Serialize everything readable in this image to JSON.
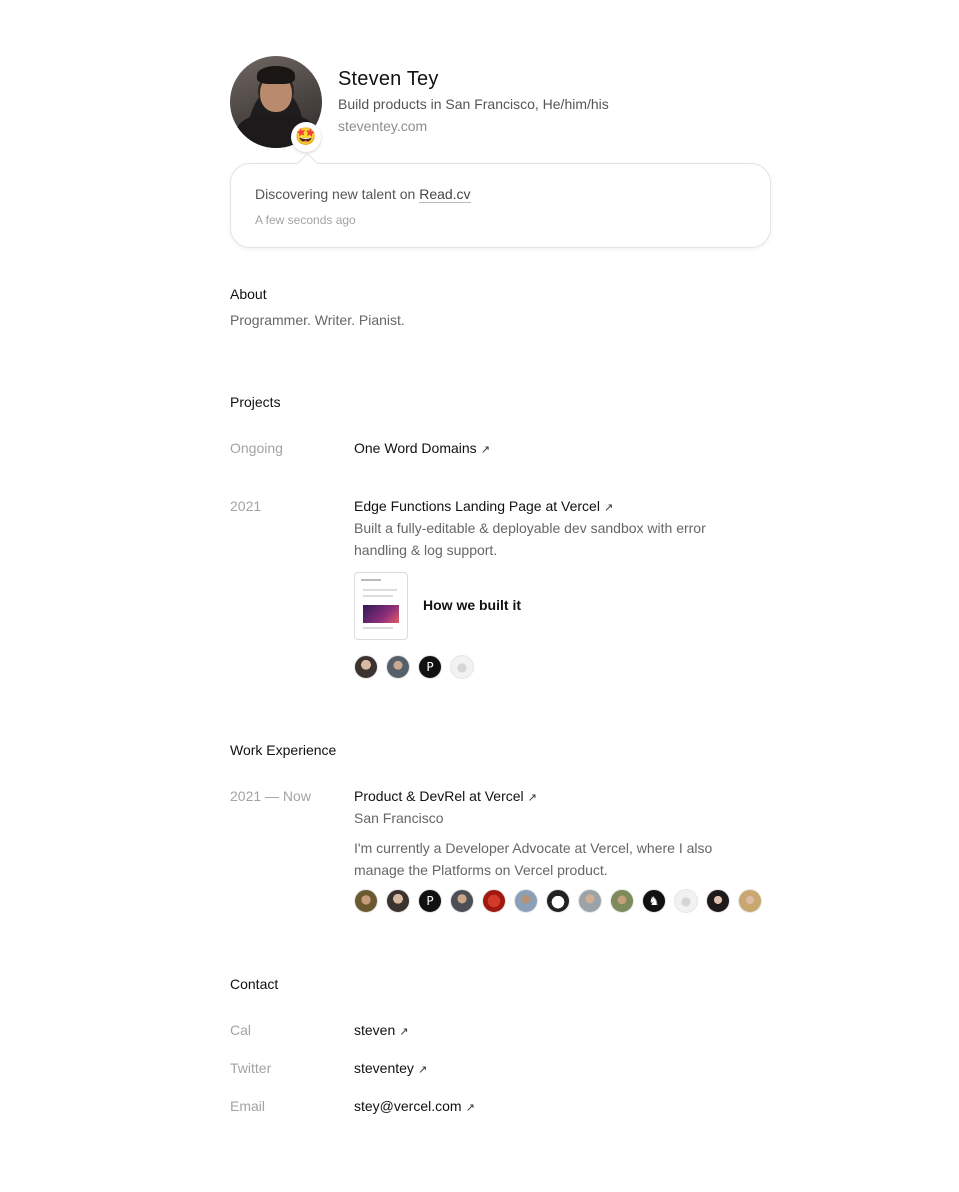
{
  "profile": {
    "name": "Steven Tey",
    "tagline": "Build products in San Francisco, He/him/his",
    "website": "steventey.com",
    "status_emoji": "🤩"
  },
  "status": {
    "text": "Discovering new talent on ",
    "link": "Read.cv",
    "time": "A few seconds ago"
  },
  "about": {
    "title": "About",
    "text": "Programmer. Writer. Pianist."
  },
  "projects": {
    "title": "Projects",
    "items": [
      {
        "date": "Ongoing",
        "title": "One Word Domains",
        "arrow": "↗"
      },
      {
        "date": "2021",
        "title": "Edge Functions Landing Page at Vercel",
        "arrow": "↗",
        "description": "Built a fully-editable & deployable dev sandbox with error handling & log support.",
        "attachment_label": "How we built it",
        "collaborators": [
          "person",
          "person",
          "P",
          "default"
        ]
      }
    ]
  },
  "work": {
    "title": "Work Experience",
    "items": [
      {
        "date": "2021 — Now",
        "title": "Product & DevRel at Vercel",
        "arrow": "↗",
        "location": "San Francisco",
        "description": "I'm currently a Developer Advocate at Vercel, where I also manage the Platforms on Vercel product.",
        "collaborators": [
          "person",
          "person",
          "P",
          "person",
          "red",
          "person",
          "dog",
          "person",
          "person",
          "rabbit",
          "default",
          "person",
          "person"
        ]
      }
    ]
  },
  "contact": {
    "title": "Contact",
    "items": [
      {
        "label": "Cal",
        "value": "steven",
        "arrow": "↗"
      },
      {
        "label": "Twitter",
        "value": "steventey",
        "arrow": "↗"
      },
      {
        "label": "Email",
        "value": "stey@vercel.com",
        "arrow": "↗"
      }
    ]
  }
}
